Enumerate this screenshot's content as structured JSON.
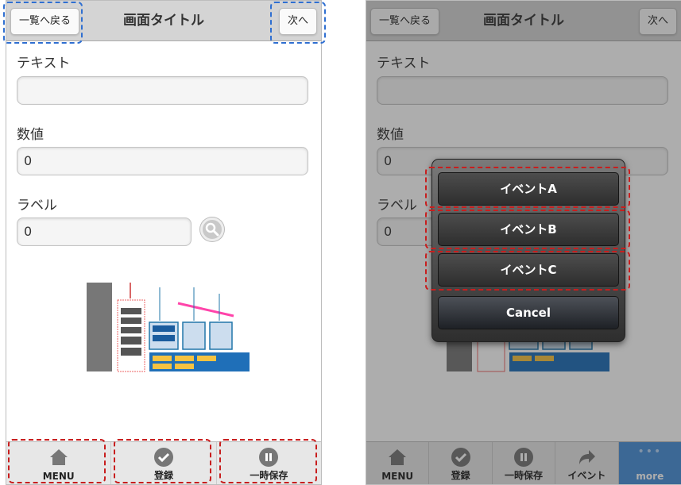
{
  "left_screen": {
    "header": {
      "back_label": "一覧へ戻る",
      "title": "画面タイトル",
      "next_label": "次へ"
    },
    "form": {
      "text_label": "テキスト",
      "text_value": "",
      "number_label": "数値",
      "number_value": "0",
      "label_label": "ラベル",
      "label_value": "0"
    },
    "footer": {
      "menu": "MENU",
      "register": "登録",
      "pause_save": "一時保存"
    }
  },
  "right_screen": {
    "header": {
      "back_label": "一覧へ戻る",
      "title": "画面タイトル",
      "next_label": "次へ"
    },
    "form": {
      "text_label": "テキスト",
      "number_label": "数値",
      "number_value": "0",
      "label_label": "ラベル",
      "label_value": "0"
    },
    "action_sheet": {
      "event_a": "イベントA",
      "event_b": "イベントB",
      "event_c": "イベントC",
      "cancel": "Cancel"
    },
    "footer": {
      "menu": "MENU",
      "register": "登録",
      "pause_save": "一時保存",
      "event": "イベント",
      "more": "more"
    }
  },
  "colors": {
    "annotation_blue": "#2f6fd1",
    "annotation_red": "#c81e1e",
    "more_tab": "#4a90d9"
  }
}
